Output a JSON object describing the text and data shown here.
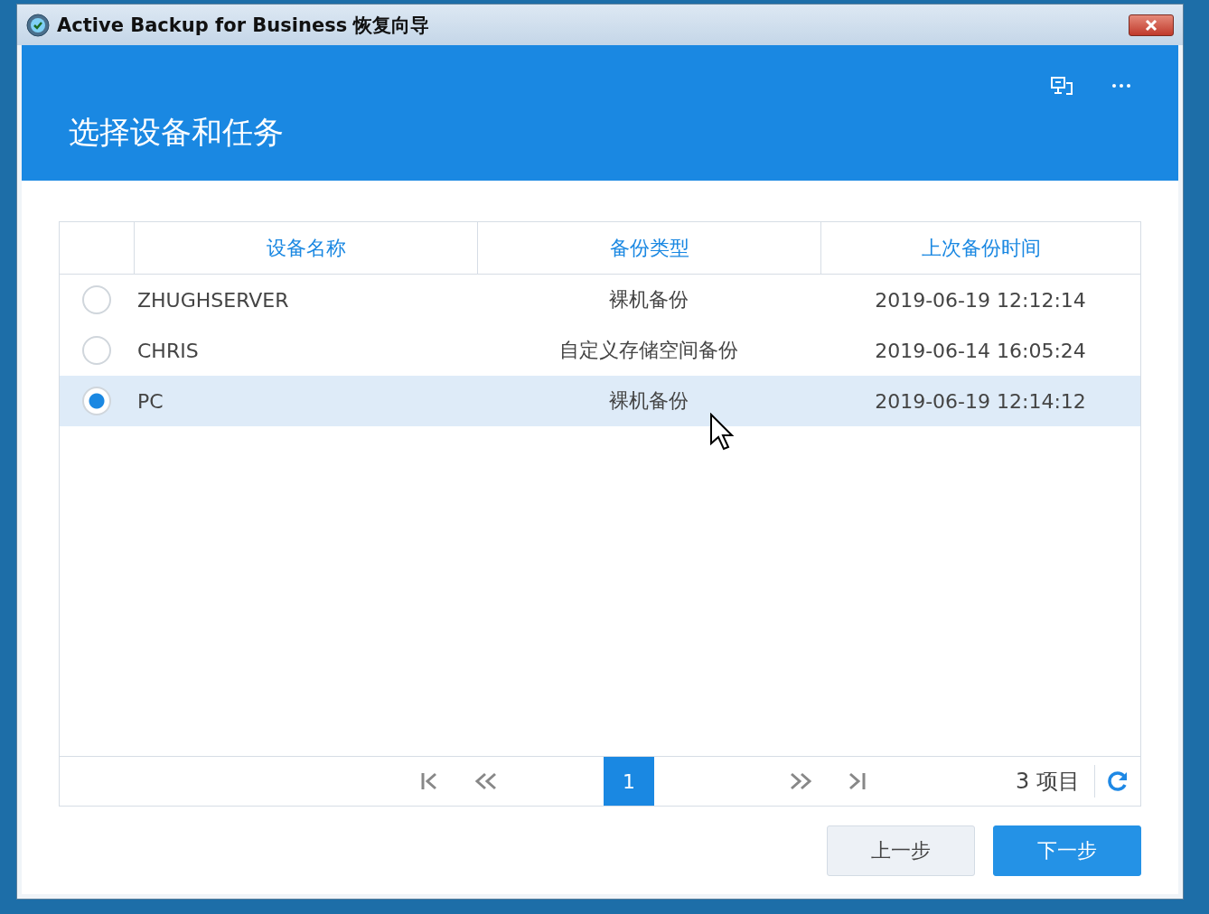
{
  "window": {
    "title": "Active Backup for Business 恢复向导"
  },
  "header": {
    "title": "选择设备和任务"
  },
  "table": {
    "columns": [
      "设备名称",
      "备份类型",
      "上次备份时间"
    ],
    "rows": [
      {
        "name": "ZHUGHSERVER",
        "type": "裸机备份",
        "time": "2019-06-19 12:12:14",
        "selected": false
      },
      {
        "name": "CHRIS",
        "type": "自定义存储空间备份",
        "time": "2019-06-14 16:05:24",
        "selected": false
      },
      {
        "name": "PC",
        "type": "裸机备份",
        "time": "2019-06-19 12:14:12",
        "selected": true
      }
    ]
  },
  "pager": {
    "pages": [
      {
        "label": "1",
        "selected": true
      }
    ],
    "count": "3 项目"
  },
  "buttons": [
    {
      "label": "上一步",
      "kind": "secondary"
    },
    {
      "label": "下一步",
      "kind": "primary"
    }
  ]
}
